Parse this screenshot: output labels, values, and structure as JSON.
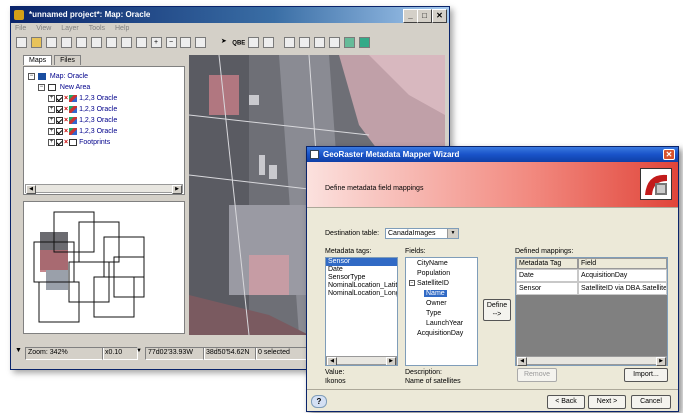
{
  "main_window": {
    "title": "*unnamed project*: Map: Oracle",
    "menu": [
      "File",
      "View",
      "Layer",
      "Tools",
      "Help"
    ],
    "toolbar_labels": {
      "qbe": "QBE"
    },
    "tabs": [
      "Maps",
      "Files"
    ],
    "tree": {
      "root": "Map: Oracle",
      "group": "New Area",
      "layers": [
        "1,2,3 Oracle",
        "1,2,3 Oracle",
        "1,2,3 Oracle",
        "1,2,3 Oracle"
      ],
      "footprints": "Footprints"
    },
    "status": {
      "zoom": "Zoom: 342%",
      "scale": "x0.10",
      "lon": "77d02'33.93W",
      "lat": "38d50'54.62N",
      "selected": "0 selected"
    }
  },
  "wizard": {
    "title": "GeoRaster Metadata Mapper Wizard",
    "banner_text": "Define metadata field mappings",
    "destination_label": "Destination table:",
    "destination_value": "CanadaImages",
    "metadata_tags_label": "Metadata tags:",
    "metadata_tags": [
      "Sensor",
      "Date",
      "SensorType",
      "NominalLocation_Latitu",
      "NominalLocation_Longit"
    ],
    "fields_label": "Fields:",
    "fields": [
      "CityName",
      "Population",
      "SatelliteID",
      "Name",
      "Owner",
      "Type",
      "LaunchYear",
      "AcquisitionDay"
    ],
    "define_button": "Define",
    "define_arrow": "-->",
    "defined_mappings_label": "Defined mappings:",
    "mapping_headers": [
      "Metadata Tag",
      "Field"
    ],
    "mappings": [
      {
        "tag": "Date",
        "field": "AcquisitionDay"
      },
      {
        "tag": "Sensor",
        "field": "SatelliteID via DBA.Satellites"
      }
    ],
    "value_label": "Value:",
    "value_text": "Ikonos",
    "description_label": "Description:",
    "description_text": "Name of satellites",
    "remove_button": "Remove",
    "import_button": "Import...",
    "back_button": "< Back",
    "next_button": "Next >",
    "cancel_button": "Cancel",
    "help_icon": "?"
  },
  "colors": {
    "title_blue": "#0a246a",
    "wizard_title_blue": "#1953c9",
    "close_red": "#d9532c",
    "banner_red": "#f05a4f"
  }
}
